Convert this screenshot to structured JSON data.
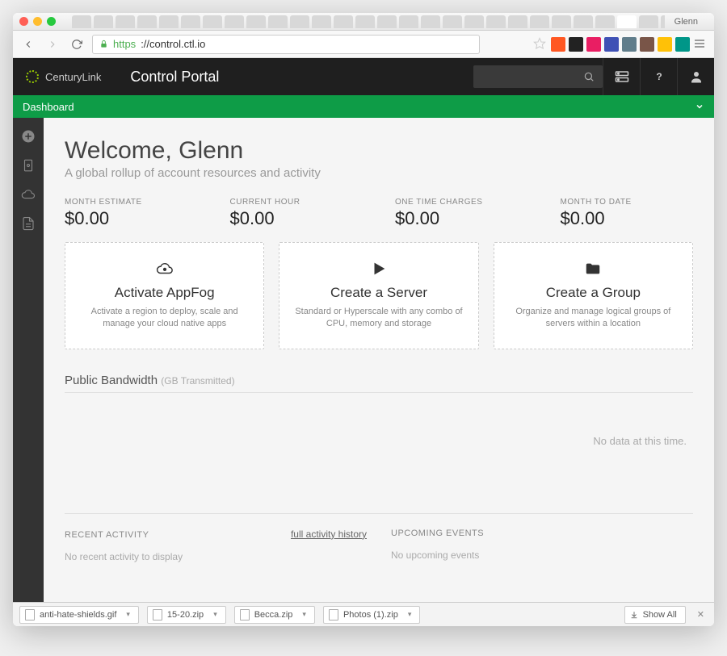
{
  "browser": {
    "profile": "Glenn",
    "url_scheme": "https",
    "url_rest": "://control.ctl.io"
  },
  "header": {
    "brand": "CenturyLink",
    "title": "Control Portal"
  },
  "green_bar": {
    "label": "Dashboard"
  },
  "welcome": {
    "title": "Welcome, Glenn",
    "subtitle": "A global rollup of account resources and activity"
  },
  "metrics": [
    {
      "label": "MONTH ESTIMATE",
      "value": "$0.00"
    },
    {
      "label": "CURRENT HOUR",
      "value": "$0.00"
    },
    {
      "label": "ONE TIME CHARGES",
      "value": "$0.00"
    },
    {
      "label": "MONTH TO DATE",
      "value": "$0.00"
    }
  ],
  "cards": [
    {
      "title": "Activate AppFog",
      "desc": "Activate a region to deploy, scale and manage your cloud native apps"
    },
    {
      "title": "Create a Server",
      "desc": "Standard or Hyperscale with any combo of CPU, memory and storage"
    },
    {
      "title": "Create a Group",
      "desc": "Organize and manage logical groups of servers within a location"
    }
  ],
  "bandwidth": {
    "title": "Public Bandwidth",
    "unit": "(GB Transmitted)",
    "empty": "No data at this time."
  },
  "recent": {
    "title": "RECENT ACTIVITY",
    "link": "full activity history",
    "empty": "No recent activity to display"
  },
  "upcoming": {
    "title": "UPCOMING EVENTS",
    "empty": "No upcoming events"
  },
  "downloads": {
    "items": [
      {
        "name": "anti-hate-shields.gif"
      },
      {
        "name": "15-20.zip"
      },
      {
        "name": "Becca.zip"
      },
      {
        "name": "Photos (1).zip"
      }
    ],
    "show_all": "Show All"
  },
  "chart_data": {
    "type": "line",
    "title": "Public Bandwidth (GB Transmitted)",
    "x": [],
    "series": [],
    "note": "No data at this time."
  }
}
